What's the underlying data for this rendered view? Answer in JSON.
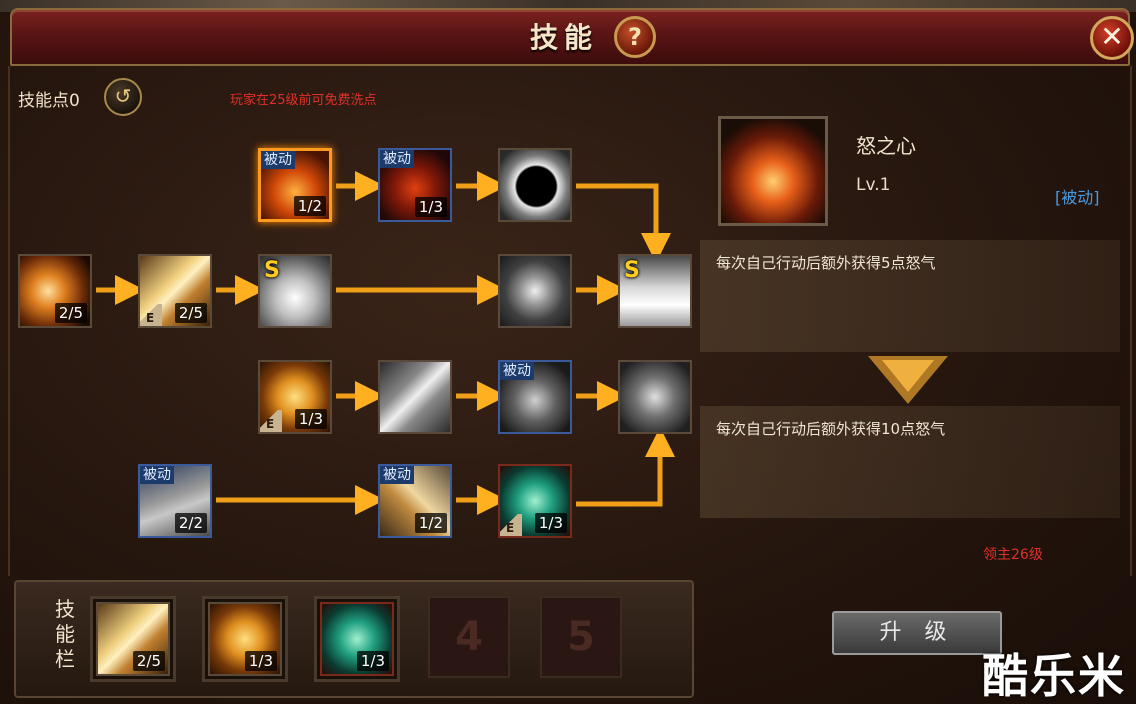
{
  "window": {
    "title": "技能",
    "help_glyph": "?",
    "close_glyph": "✕"
  },
  "header": {
    "skill_points_label": "技能点0",
    "reset_glyph": "↺",
    "free_reset_note": "玩家在25级前可免费洗点"
  },
  "tree": {
    "row1": [
      {
        "id": "t11",
        "passive": "被动",
        "level": "1/2",
        "art": "fire",
        "selected": true
      },
      {
        "id": "t12",
        "passive": "被动",
        "level": "1/3",
        "art": "shield-red"
      },
      {
        "id": "t13",
        "art": "eclipse"
      }
    ],
    "row2": [
      {
        "id": "t21",
        "level": "2/5",
        "art": "slash"
      },
      {
        "id": "t22",
        "e": "E",
        "level": "2/5",
        "art": "sword"
      },
      {
        "id": "t23",
        "s": "S",
        "art": "greatsword"
      },
      {
        "id": "t24",
        "art": "vortex"
      },
      {
        "id": "t25",
        "s": "S",
        "art": "white-blades"
      }
    ],
    "row3": [
      {
        "id": "t31",
        "e": "E",
        "level": "1/3",
        "art": "golden-shield"
      },
      {
        "id": "t32",
        "art": "streaks"
      },
      {
        "id": "t33",
        "passive": "被动",
        "art": "guardian"
      },
      {
        "id": "t34",
        "art": "team-shield"
      }
    ],
    "row4": [
      {
        "id": "t41",
        "passive": "被动",
        "level": "2/2",
        "art": "stone"
      },
      {
        "id": "t42",
        "passive": "被动",
        "level": "1/2",
        "art": "spear"
      },
      {
        "id": "t43",
        "e": "E",
        "level": "1/3",
        "art": "green-warrior"
      }
    ]
  },
  "detail": {
    "name": "怒之心",
    "level": "Lv.1",
    "type": "[被动]",
    "current_effect": "每次自己行动后额外获得5点怒气",
    "next_effect": "每次自己行动后额外获得10点怒气",
    "requirement": "领主26级"
  },
  "skillbar": {
    "label_chars": [
      "技",
      "能",
      "栏"
    ],
    "slots": [
      {
        "level": "2/5",
        "art": "sword"
      },
      {
        "level": "1/3",
        "art": "golden-shield"
      },
      {
        "level": "1/3",
        "art": "green-warrior"
      },
      {
        "number": "4"
      },
      {
        "number": "5"
      }
    ]
  },
  "actions": {
    "upgrade_label": "升 级"
  },
  "watermark": "酷乐米",
  "colors": {
    "accent": "#ff9a20",
    "warning": "#e03028",
    "passive_tag": "#4a9ae0"
  }
}
